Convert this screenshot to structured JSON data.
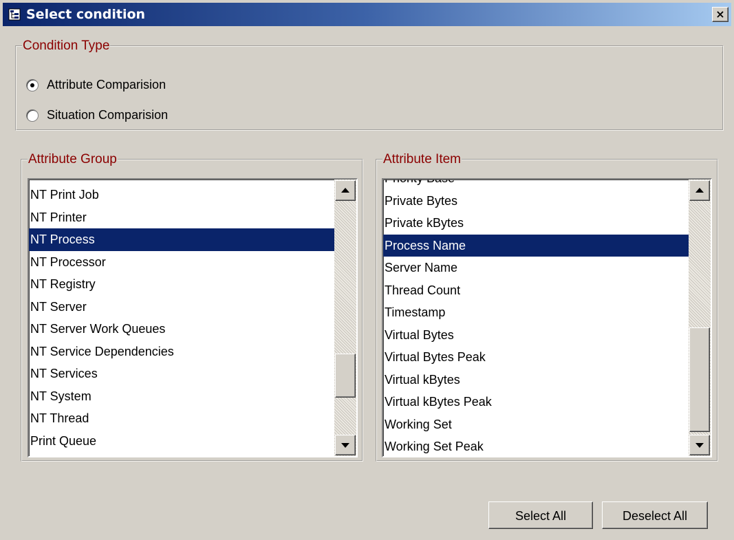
{
  "window": {
    "title": "Select condition",
    "close_label": "×"
  },
  "condition_type": {
    "legend": "Condition Type",
    "options": [
      {
        "label": "Attribute Comparision",
        "selected": true
      },
      {
        "label": "Situation Comparision",
        "selected": false
      }
    ]
  },
  "attribute_group": {
    "legend": "Attribute Group",
    "items": [
      "NT Print Job",
      "NT Printer",
      "NT Process",
      "NT Processor",
      "NT Registry",
      "NT Server",
      "NT Server Work Queues",
      "NT Service Dependencies",
      "NT Services",
      "NT System",
      "NT Thread",
      "Print Queue"
    ],
    "selected": "NT Process"
  },
  "attribute_item": {
    "legend": "Attribute Item",
    "items": [
      "Priority Base",
      "Private Bytes",
      "Private kBytes",
      "Process Name",
      "Server Name",
      "Thread Count",
      "Timestamp",
      "Virtual Bytes",
      "Virtual Bytes Peak",
      "Virtual kBytes",
      "Virtual kBytes Peak",
      "Working Set",
      "Working Set Peak"
    ],
    "selected": "Process Name"
  },
  "buttons": {
    "select_all": "Select All",
    "deselect_all": "Deselect All"
  },
  "colors": {
    "legend": "#8b0000",
    "selection": "#0a246a",
    "title_start": "#0a246a",
    "title_end": "#a6caf0"
  }
}
